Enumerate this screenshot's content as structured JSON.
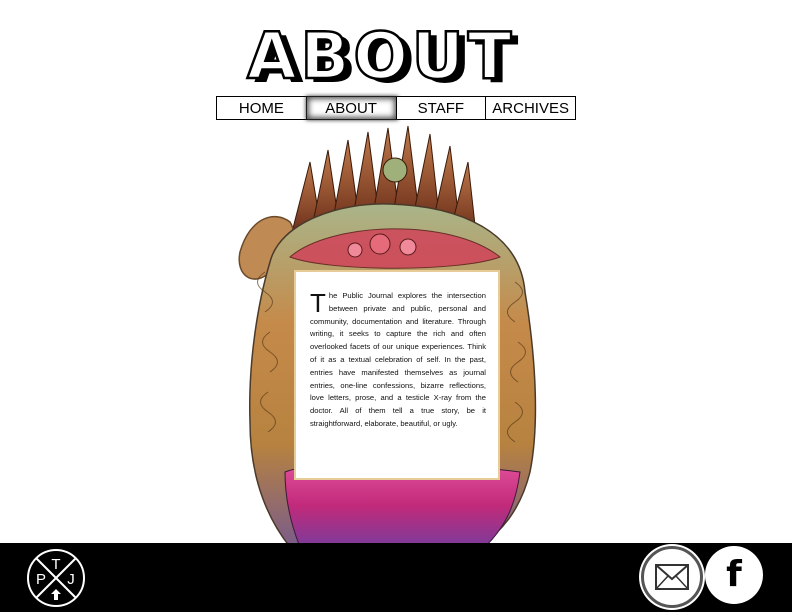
{
  "header": {
    "title": "ABOUT"
  },
  "nav": {
    "items": [
      {
        "label": "HOME"
      },
      {
        "label": "ABOUT",
        "active": true
      },
      {
        "label": "STAFF"
      },
      {
        "label": "ARCHIVES"
      }
    ]
  },
  "about": {
    "dropcap": "T",
    "body": "he Public Journal explores the intersection between private and public, personal and community, documentation and literature. Through writing, it seeks to capture the rich and often overlooked facets of our unique experiences. Think of it as a textual celebration of self. In the past, entries have manifested themselves as journal entries, one-line confessions, bizarre reflections, love letters, prose, and a testicle X-ray from the doctor. All of them tell a true story, be it straightforward, elaborate, beautiful, or ugly."
  },
  "footer": {
    "logo": {
      "letters": {
        "top": "T",
        "left": "P",
        "right": "J"
      },
      "icon": "ptj-logo-icon"
    },
    "social": [
      {
        "icon": "envelope-icon"
      },
      {
        "icon": "facebook-icon",
        "glyph": "f"
      }
    ]
  },
  "colors": {
    "background": "#ffffff",
    "footer": "#000000",
    "card_border": "#e7cc9a",
    "art_pink": "#d83a8a",
    "art_brown": "#8a4a2a"
  }
}
